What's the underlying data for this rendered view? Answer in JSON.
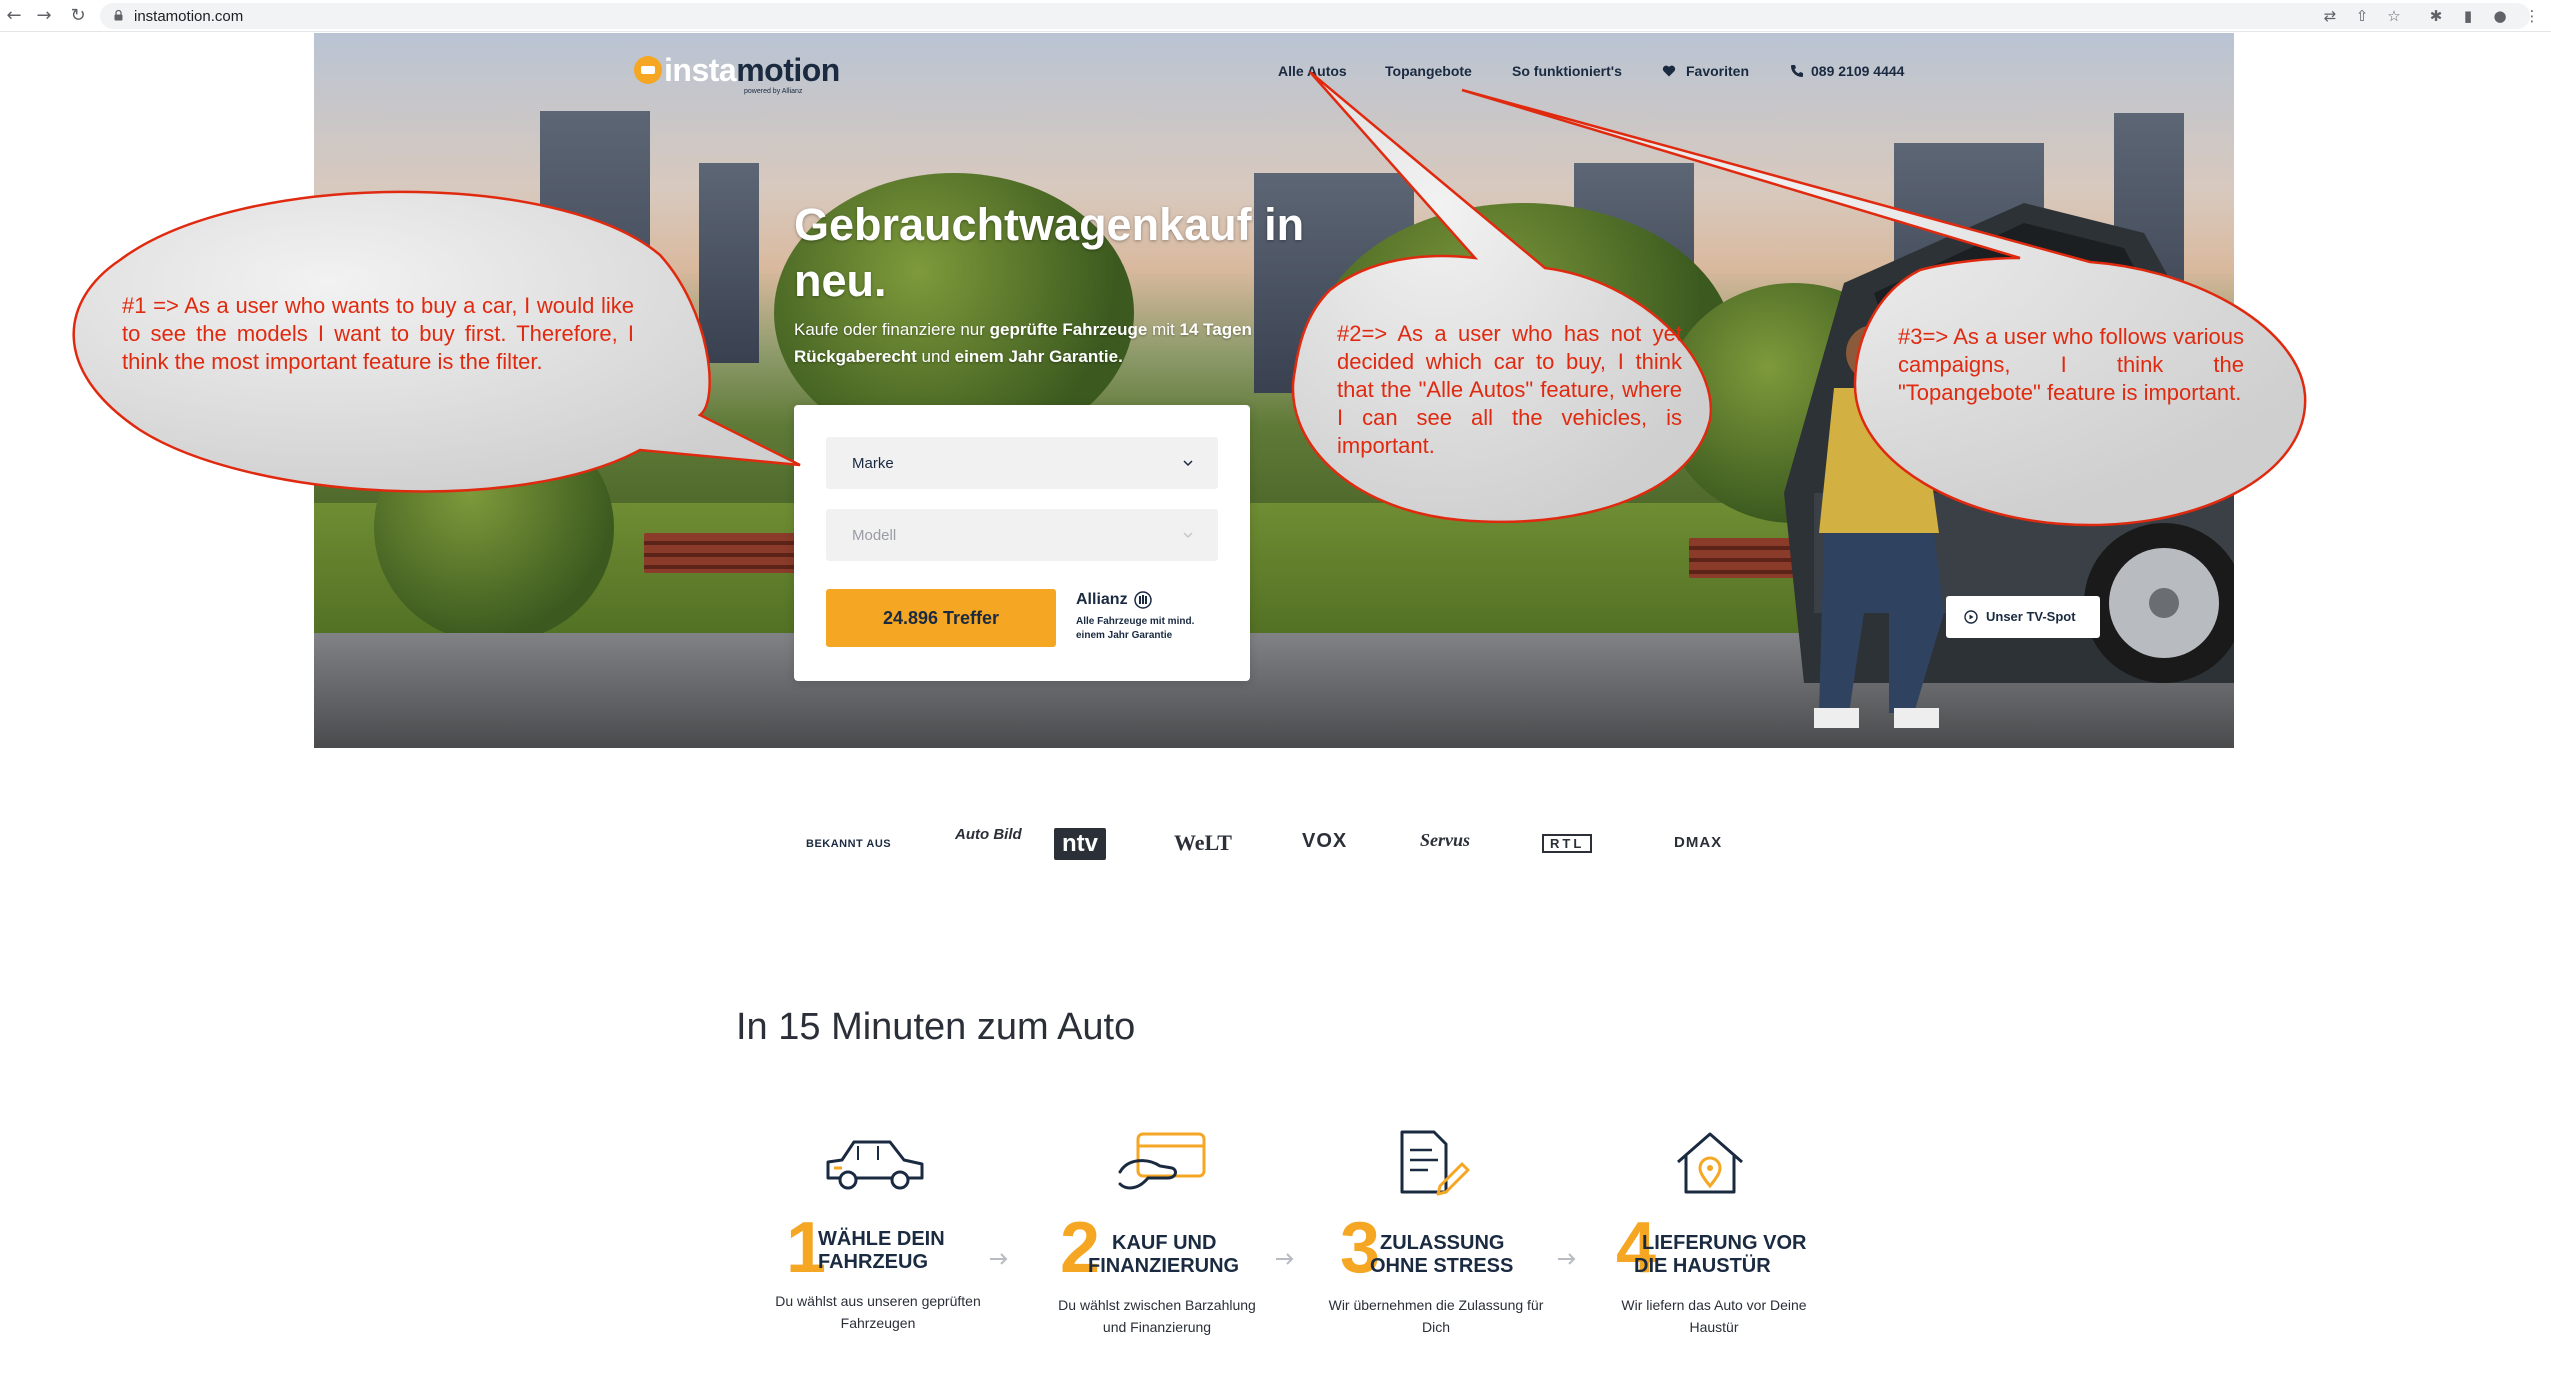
{
  "browser": {
    "url": "instamotion.com",
    "back_glyph": "←",
    "forward_glyph": "→",
    "reload_glyph": "↻",
    "translate_glyph": "⇄",
    "share_glyph": "⇧",
    "star_glyph": "☆",
    "extensions_glyph": "✱",
    "sidepanel_glyph": "▮",
    "profile_glyph": "●",
    "menu_glyph": "⋮"
  },
  "brand": {
    "name_part1": "insta",
    "name_part2": "motion",
    "tagline": "powered by Allianz",
    "accent_color": "#f5a623",
    "navy_color": "#1a2a40"
  },
  "nav": {
    "items": [
      {
        "label": "Alle Autos"
      },
      {
        "label": "Topangebote"
      },
      {
        "label": "So funktioniert's"
      },
      {
        "label": "Favoriten"
      },
      {
        "label": "089 2109 4444"
      }
    ]
  },
  "hero": {
    "title": "Gebrauchtwagenkauf in neu.",
    "sub_part1": "Kaufe oder finanziere nur ",
    "sub_bold1": "geprüfte Fahrzeuge",
    "sub_part2": " mit ",
    "sub_bold2": "14 Tagen Rückgaberecht",
    "sub_part3": " und ",
    "sub_bold3": "einem Jahr Garantie."
  },
  "search": {
    "make_label": "Marke",
    "model_label": "Modell",
    "cta_label": "24.896 Treffer",
    "allianz_name": "Allianz",
    "allianz_note": "Alle Fahrzeuge mit mind. einem Jahr Garantie"
  },
  "tv_spot": {
    "label": "Unser TV-Spot"
  },
  "press": {
    "label": "BEKANNT AUS",
    "logos": [
      "Auto Bild",
      "ntv",
      "WeLT",
      "VOX",
      "Servus",
      "RTL",
      "DMAX"
    ]
  },
  "steps": {
    "title": "In 15 Minuten zum Auto",
    "items": [
      {
        "number": "1",
        "heading_line1": "WÄHLE DEIN",
        "heading_line2": "FAHRZEUG",
        "desc": "Du wählst aus unseren geprüften Fahrzeugen",
        "icon": "car-icon"
      },
      {
        "number": "2",
        "heading_line1": "KAUF UND",
        "heading_line2": "FINANZIERUNG",
        "desc": "Du wählst zwischen Barzahlung und Finanzierung",
        "icon": "credit-card-icon"
      },
      {
        "number": "3",
        "heading_line1": "ZULASSUNG",
        "heading_line2": "OHNE STRESS",
        "desc": "Wir übernehmen die Zulassung für Dich",
        "icon": "document-pen-icon"
      },
      {
        "number": "4",
        "heading_line1": "LIEFERUNG VOR",
        "heading_line2": "DIE HAUSTÜR",
        "desc": "Wir liefern das Auto vor Deine Haustür",
        "icon": "house-location-icon"
      }
    ]
  },
  "annotations": [
    {
      "text": "#1 => As a user who wants to buy a car, I would like to see the models I want to buy first. Therefore, I think the most important feature is the filter."
    },
    {
      "text": "#2=> As a user who has not yet decided which car to buy, I think that the \"Alle Autos\" feature, where I can see all the vehicles, is important."
    },
    {
      "text": "#3=> As a user who follows various campaigns, I think the \"Topangebote\" feature is important."
    }
  ]
}
